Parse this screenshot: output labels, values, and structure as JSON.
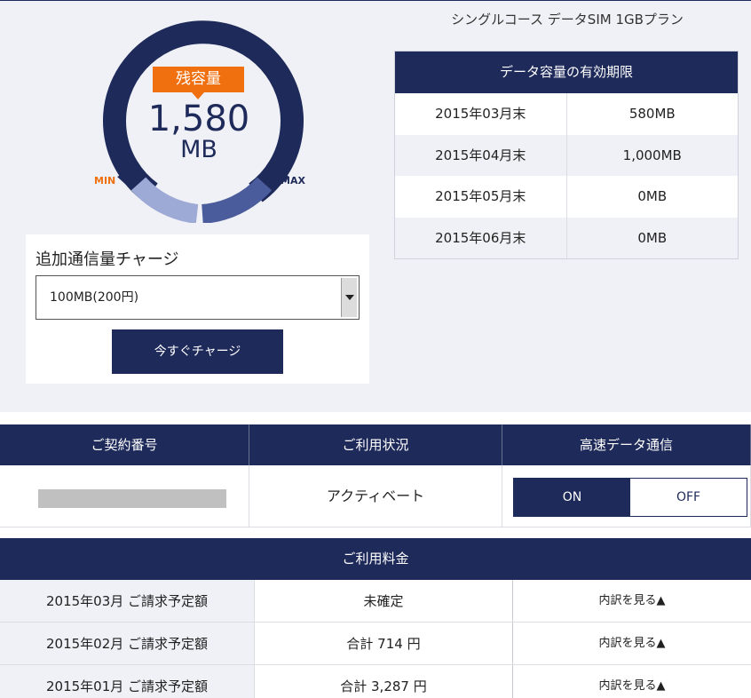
{
  "plan": {
    "name": "シングルコース データSIM 1GBプラン"
  },
  "gauge": {
    "badge": "残容量",
    "value": "1,580",
    "unit": "MB",
    "min_label": "MIN",
    "max_label": "MAX",
    "colors": {
      "ring": "#1e2a5a",
      "light": "#9eaad6",
      "mid": "#4b5c9c",
      "badge": "#f07010"
    }
  },
  "validity": {
    "title": "データ容量の有効期限",
    "rows": [
      {
        "month": "2015年03月末",
        "amount": "580MB"
      },
      {
        "month": "2015年04月末",
        "amount": "1,000MB"
      },
      {
        "month": "2015年05月末",
        "amount": "0MB"
      },
      {
        "month": "2015年06月末",
        "amount": "0MB"
      }
    ]
  },
  "charge": {
    "title": "追加通信量チャージ",
    "selected": "100MB(200円)",
    "button": "今すぐチャージ"
  },
  "contract": {
    "headers": [
      "ご契約番号",
      "ご利用状況",
      "高速データ通信"
    ],
    "status": "アクティベート",
    "toggle_on": "ON",
    "toggle_off": "OFF"
  },
  "billing": {
    "title": "ご利用料金",
    "rows": [
      {
        "label": "2015年03月 ご請求予定額",
        "amount": "未確定",
        "link": "内訳を見る▲"
      },
      {
        "label": "2015年02月 ご請求予定額",
        "amount": "合計 714 円",
        "link": "内訳を見る▲"
      },
      {
        "label": "2015年01月 ご請求予定額",
        "amount": "合計 3,287 円",
        "link": "内訳を見る▲"
      }
    ]
  },
  "accent_color": "#1e2a5a"
}
